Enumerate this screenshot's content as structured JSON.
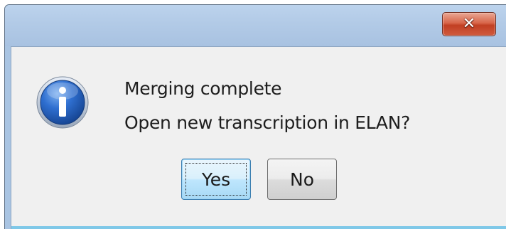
{
  "dialog": {
    "close_glyph": "✕",
    "message_line1": "Merging complete",
    "message_line2": "Open new transcription in ELAN?",
    "icon": "information-icon",
    "buttons": {
      "yes_label": "Yes",
      "no_label": "No"
    },
    "colors": {
      "titlebar": "#b3cbe7",
      "close_button": "#c13f22",
      "client_background": "#f0f0f0",
      "default_button_border": "#3c7fb1"
    }
  }
}
